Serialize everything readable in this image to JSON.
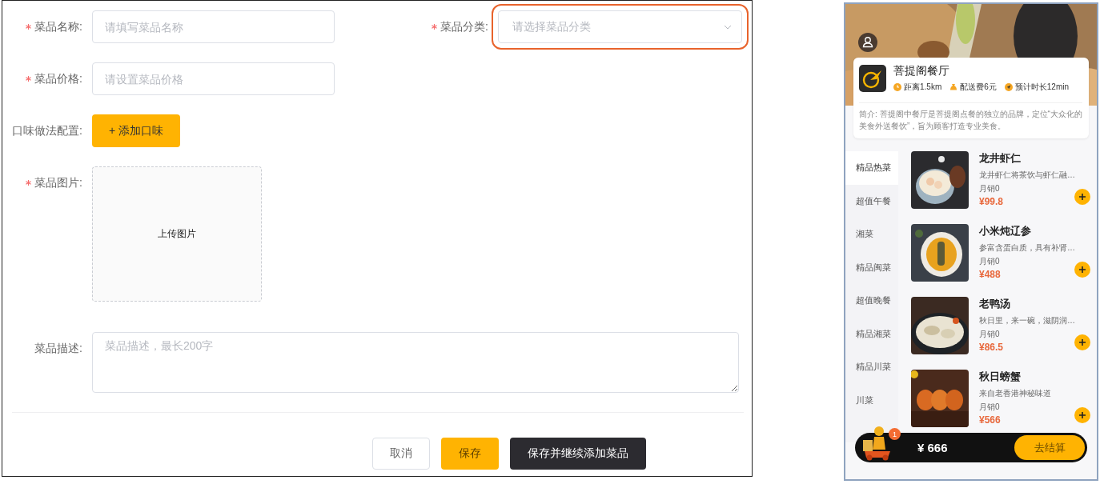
{
  "form": {
    "fields": [
      {
        "kind": "text",
        "label": "菜品名称:",
        "required": true,
        "placeholder": "请填写菜品名称"
      },
      {
        "kind": "select",
        "label": "菜品分类:",
        "required": true,
        "placeholder": "请选择菜品分类",
        "highlighted": true
      },
      {
        "kind": "text",
        "label": "菜品价格:",
        "required": true,
        "placeholder": "请设置菜品价格"
      },
      {
        "kind": "button",
        "label": "口味做法配置:",
        "required": false,
        "button": "+ 添加口味"
      },
      {
        "kind": "upload",
        "label": "菜品图片:",
        "required": true,
        "text": "上传图片"
      },
      {
        "kind": "textarea",
        "label": "菜品描述:",
        "required": false,
        "placeholder": "菜品描述，最长200字"
      }
    ],
    "buttons": [
      {
        "kind": "default",
        "label": "取消"
      },
      {
        "kind": "primary",
        "label": "保存"
      },
      {
        "kind": "dark",
        "label": "保存并继续添加菜品"
      }
    ]
  },
  "preview": {
    "restaurant": {
      "name": "菩提阁餐厅",
      "meta": [
        {
          "kind": "distance",
          "text": "距离1.5km"
        },
        {
          "kind": "fee",
          "text": "配送费6元"
        },
        {
          "kind": "time",
          "text": "预计时长12min"
        }
      ],
      "intro": "简介: 菩提阁中餐厅是菩提阁点餐的独立的品牌，定位“大众化的美食外送餐饮”，旨为顾客打造专业美食。"
    },
    "categories": [
      {
        "name": "精品热菜",
        "selected": true
      },
      {
        "name": "超值午餐",
        "selected": false
      },
      {
        "name": "湘菜",
        "selected": false
      },
      {
        "name": "精品闽菜",
        "selected": false
      },
      {
        "name": "超值晚餐",
        "selected": false
      },
      {
        "name": "精品湘菜",
        "selected": false
      },
      {
        "name": "精品川菜",
        "selected": false
      },
      {
        "name": "川菜",
        "selected": false
      }
    ],
    "dishes": [
      {
        "name": "龙井虾仁",
        "desc": "龙井虾仁将茶饮与虾仁融…",
        "sales": "月销0",
        "price": "¥99.8"
      },
      {
        "name": "小米炖辽参",
        "desc": "参富含蛋白质，具有补肾…",
        "sales": "月销0",
        "price": "¥488"
      },
      {
        "name": "老鸭汤",
        "desc": "秋日里，来一碗，滋阴润…",
        "sales": "月销0",
        "price": "¥86.5"
      },
      {
        "name": "秋日螃蟹",
        "desc": "来自老香港神秘味道",
        "sales": "月销0",
        "price": "¥566"
      }
    ],
    "cart": {
      "count": "1",
      "total": "¥ 666",
      "checkout": "去结算"
    }
  }
}
